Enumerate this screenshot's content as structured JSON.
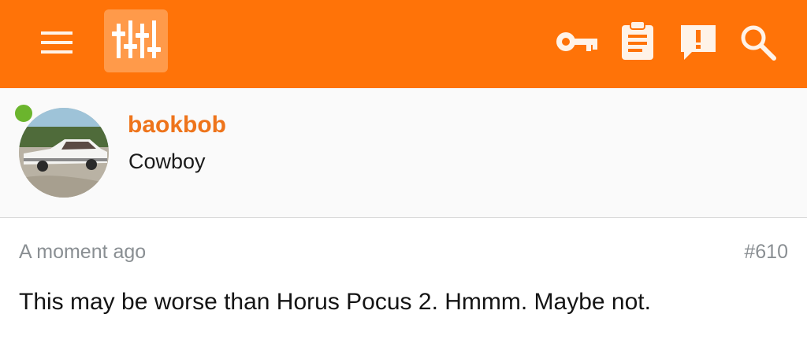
{
  "header": {
    "background_color": "#ff7308",
    "menu_icon": "hamburger-menu-icon",
    "logo_icon": "sliders-logo-icon",
    "actions": [
      {
        "icon": "key-icon"
      },
      {
        "icon": "clipboard-icon"
      },
      {
        "icon": "report-alert-icon"
      },
      {
        "icon": "search-icon"
      }
    ]
  },
  "user": {
    "name": "baokbob",
    "title": "Cowboy",
    "online": true,
    "online_color": "#6bb52d",
    "name_color": "#ee741b"
  },
  "post": {
    "time": "A moment ago",
    "number": "#610",
    "body": "This may be worse than Horus Pocus 2. Hmmm. Maybe not."
  }
}
